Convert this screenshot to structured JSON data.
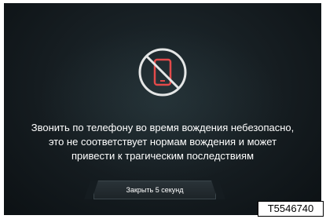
{
  "dialog": {
    "icon": "no-phone-icon",
    "message_lines": [
      "Звонить по телефону во время вождения небезопасно,",
      "это не соответствует нормам вождения и может",
      "привести к трагическим последствиям"
    ],
    "close_button_label": "Закрыть 5 секунд"
  },
  "figure_reference": "T5546740",
  "colors": {
    "background": "#151c20",
    "icon_outline": "#e4e6e6",
    "phone_accent": "#e24a4a",
    "text": "#ffffff"
  }
}
